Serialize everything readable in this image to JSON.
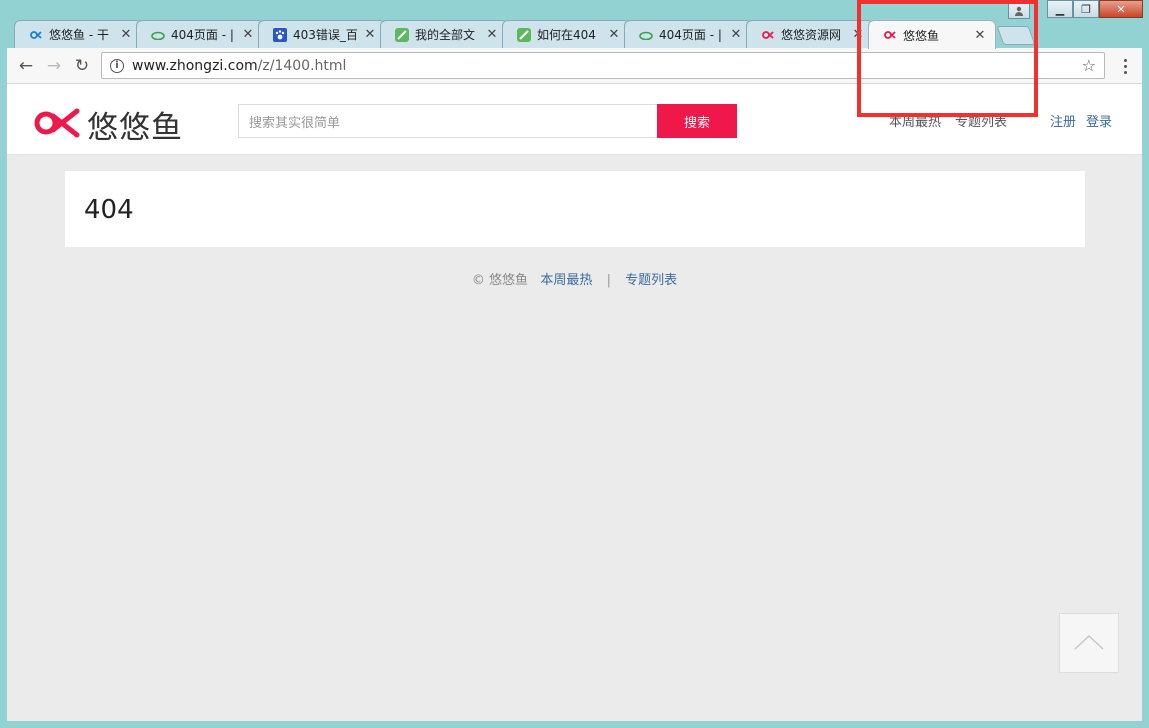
{
  "tabs": [
    {
      "title": "悠悠鱼 - 干",
      "icon": "youyouyu-logo-icon",
      "active": false
    },
    {
      "title": "404页面 - |",
      "icon": "green-cloud-icon",
      "active": false
    },
    {
      "title": "403错误_百",
      "icon": "baidu-paw-icon",
      "active": false
    },
    {
      "title": "我的全部文",
      "icon": "green-leaf-icon",
      "active": false
    },
    {
      "title": "如何在404",
      "icon": "green-leaf-icon",
      "active": false
    },
    {
      "title": "404页面 - |",
      "icon": "green-cloud-icon",
      "active": false
    },
    {
      "title": "悠悠资源网",
      "icon": "youyouyu-logo-icon",
      "active": false
    },
    {
      "title": "悠悠鱼",
      "icon": "youyouyu-logo-icon",
      "active": true
    }
  ],
  "address": {
    "host": "www.zhongzi.com",
    "path": "/z/1400.html"
  },
  "site": {
    "logo_text": "悠悠鱼",
    "search_placeholder": "搜索其实很简单",
    "search_button": "搜索",
    "nav": [
      "本周最热",
      "专题列表"
    ],
    "auth": [
      "注册",
      "登录"
    ]
  },
  "content": {
    "error_code": "404"
  },
  "footer": {
    "copyright": "© 悠悠鱼",
    "links": [
      "本周最热",
      "专题列表"
    ],
    "separator": "|"
  },
  "colors": {
    "brand": "#f0174a",
    "link": "#3d6b9e",
    "highlight": "#f0312e"
  }
}
